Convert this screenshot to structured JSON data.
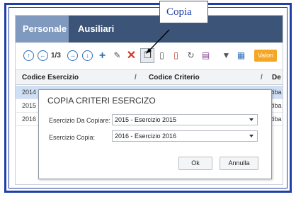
{
  "tabs": [
    {
      "label": "Personale",
      "active": true
    },
    {
      "label": "Ausiliari",
      "active": false
    }
  ],
  "callout": {
    "label": "Copia"
  },
  "toolbar": {
    "page_indicator": "1/3",
    "valori_label": "Valori",
    "icons": [
      "first-page-icon",
      "previous-page-icon",
      "next-page-icon",
      "last-page-icon",
      "add-icon",
      "edit-icon",
      "delete-icon",
      "copy-icon",
      "new-document-icon",
      "delete-document-icon",
      "refresh-icon",
      "print-icon",
      "filter-icon",
      "columns-icon"
    ]
  },
  "grid": {
    "columns": [
      "Codice Esercizio",
      "Codice Criterio",
      "De"
    ],
    "rows": [
      {
        "codice": "2014",
        "tail": "Riba",
        "selected": true
      },
      {
        "codice": "2015",
        "tail": "Riba",
        "selected": false
      },
      {
        "codice": "2016",
        "tail": "Riba",
        "selected": false
      }
    ]
  },
  "dialog": {
    "title": "COPIA CRITERI ESERCIZO",
    "fields": [
      {
        "label": "Esercizio Da Copiare:",
        "value": "2015 - Esercizio 2015"
      },
      {
        "label": "Esercizio Copia:",
        "value": "2016 - Esercizio 2016"
      }
    ],
    "ok_label": "Ok",
    "cancel_label": "Annulla"
  },
  "colors": {
    "frame": "#1f3fa6",
    "tabbar": "#3b5478",
    "active_tab": "#7f99bf",
    "accent": "#f5a623",
    "icon": "#2d6fb6"
  }
}
